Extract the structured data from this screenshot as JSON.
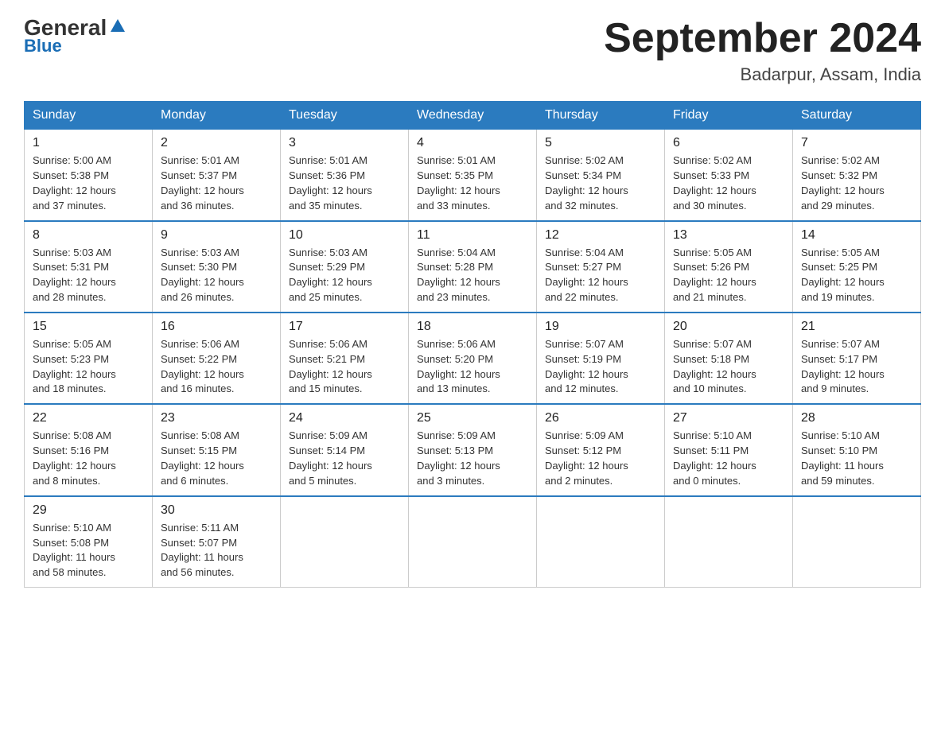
{
  "header": {
    "logo_general": "General",
    "logo_blue": "Blue",
    "month_title": "September 2024",
    "location": "Badarpur, Assam, India"
  },
  "days_of_week": [
    "Sunday",
    "Monday",
    "Tuesday",
    "Wednesday",
    "Thursday",
    "Friday",
    "Saturday"
  ],
  "weeks": [
    [
      {
        "day": "1",
        "sunrise": "5:00 AM",
        "sunset": "5:38 PM",
        "daylight": "12 hours and 37 minutes."
      },
      {
        "day": "2",
        "sunrise": "5:01 AM",
        "sunset": "5:37 PM",
        "daylight": "12 hours and 36 minutes."
      },
      {
        "day": "3",
        "sunrise": "5:01 AM",
        "sunset": "5:36 PM",
        "daylight": "12 hours and 35 minutes."
      },
      {
        "day": "4",
        "sunrise": "5:01 AM",
        "sunset": "5:35 PM",
        "daylight": "12 hours and 33 minutes."
      },
      {
        "day": "5",
        "sunrise": "5:02 AM",
        "sunset": "5:34 PM",
        "daylight": "12 hours and 32 minutes."
      },
      {
        "day": "6",
        "sunrise": "5:02 AM",
        "sunset": "5:33 PM",
        "daylight": "12 hours and 30 minutes."
      },
      {
        "day": "7",
        "sunrise": "5:02 AM",
        "sunset": "5:32 PM",
        "daylight": "12 hours and 29 minutes."
      }
    ],
    [
      {
        "day": "8",
        "sunrise": "5:03 AM",
        "sunset": "5:31 PM",
        "daylight": "12 hours and 28 minutes."
      },
      {
        "day": "9",
        "sunrise": "5:03 AM",
        "sunset": "5:30 PM",
        "daylight": "12 hours and 26 minutes."
      },
      {
        "day": "10",
        "sunrise": "5:03 AM",
        "sunset": "5:29 PM",
        "daylight": "12 hours and 25 minutes."
      },
      {
        "day": "11",
        "sunrise": "5:04 AM",
        "sunset": "5:28 PM",
        "daylight": "12 hours and 23 minutes."
      },
      {
        "day": "12",
        "sunrise": "5:04 AM",
        "sunset": "5:27 PM",
        "daylight": "12 hours and 22 minutes."
      },
      {
        "day": "13",
        "sunrise": "5:05 AM",
        "sunset": "5:26 PM",
        "daylight": "12 hours and 21 minutes."
      },
      {
        "day": "14",
        "sunrise": "5:05 AM",
        "sunset": "5:25 PM",
        "daylight": "12 hours and 19 minutes."
      }
    ],
    [
      {
        "day": "15",
        "sunrise": "5:05 AM",
        "sunset": "5:23 PM",
        "daylight": "12 hours and 18 minutes."
      },
      {
        "day": "16",
        "sunrise": "5:06 AM",
        "sunset": "5:22 PM",
        "daylight": "12 hours and 16 minutes."
      },
      {
        "day": "17",
        "sunrise": "5:06 AM",
        "sunset": "5:21 PM",
        "daylight": "12 hours and 15 minutes."
      },
      {
        "day": "18",
        "sunrise": "5:06 AM",
        "sunset": "5:20 PM",
        "daylight": "12 hours and 13 minutes."
      },
      {
        "day": "19",
        "sunrise": "5:07 AM",
        "sunset": "5:19 PM",
        "daylight": "12 hours and 12 minutes."
      },
      {
        "day": "20",
        "sunrise": "5:07 AM",
        "sunset": "5:18 PM",
        "daylight": "12 hours and 10 minutes."
      },
      {
        "day": "21",
        "sunrise": "5:07 AM",
        "sunset": "5:17 PM",
        "daylight": "12 hours and 9 minutes."
      }
    ],
    [
      {
        "day": "22",
        "sunrise": "5:08 AM",
        "sunset": "5:16 PM",
        "daylight": "12 hours and 8 minutes."
      },
      {
        "day": "23",
        "sunrise": "5:08 AM",
        "sunset": "5:15 PM",
        "daylight": "12 hours and 6 minutes."
      },
      {
        "day": "24",
        "sunrise": "5:09 AM",
        "sunset": "5:14 PM",
        "daylight": "12 hours and 5 minutes."
      },
      {
        "day": "25",
        "sunrise": "5:09 AM",
        "sunset": "5:13 PM",
        "daylight": "12 hours and 3 minutes."
      },
      {
        "day": "26",
        "sunrise": "5:09 AM",
        "sunset": "5:12 PM",
        "daylight": "12 hours and 2 minutes."
      },
      {
        "day": "27",
        "sunrise": "5:10 AM",
        "sunset": "5:11 PM",
        "daylight": "12 hours and 0 minutes."
      },
      {
        "day": "28",
        "sunrise": "5:10 AM",
        "sunset": "5:10 PM",
        "daylight": "11 hours and 59 minutes."
      }
    ],
    [
      {
        "day": "29",
        "sunrise": "5:10 AM",
        "sunset": "5:08 PM",
        "daylight": "11 hours and 58 minutes."
      },
      {
        "day": "30",
        "sunrise": "5:11 AM",
        "sunset": "5:07 PM",
        "daylight": "11 hours and 56 minutes."
      },
      null,
      null,
      null,
      null,
      null
    ]
  ],
  "labels": {
    "sunrise_prefix": "Sunrise: ",
    "sunset_prefix": "Sunset: ",
    "daylight_prefix": "Daylight: "
  }
}
